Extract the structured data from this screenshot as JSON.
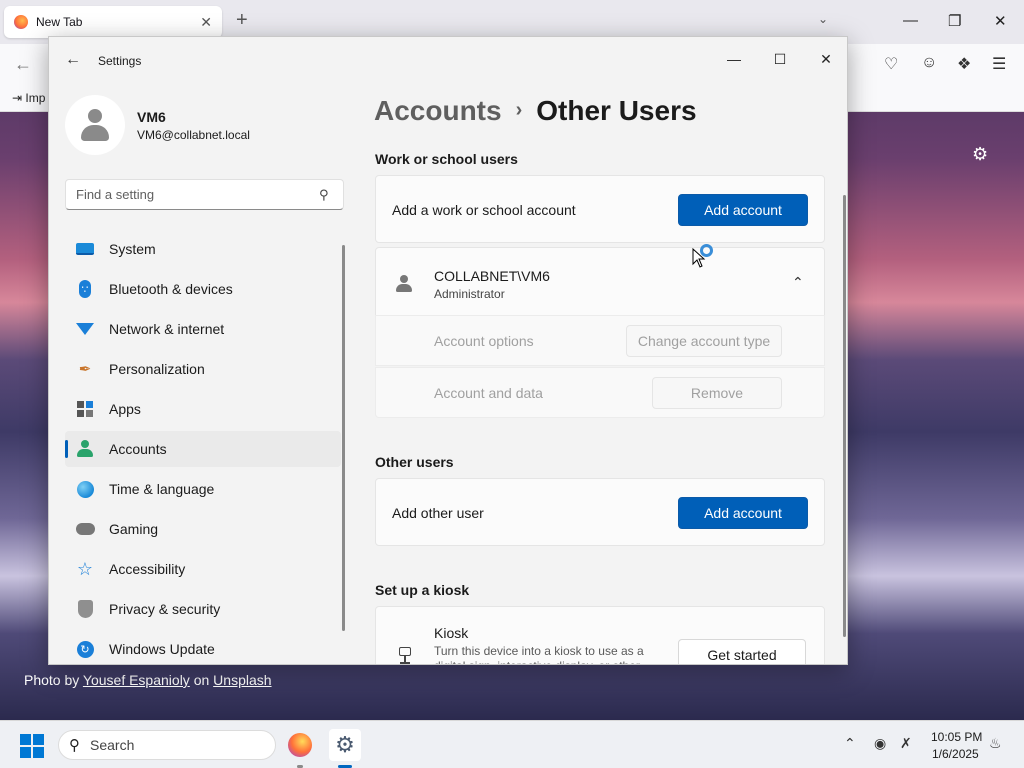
{
  "browser": {
    "tab_title": "New Tab",
    "tab_close": "✕",
    "new_tab": "+",
    "bookmark_import": "Imp",
    "photo_credit_prefix": "Photo by ",
    "photo_author": "Yousef Espanioly",
    "photo_credit_mid": " on ",
    "photo_site": "Unsplash"
  },
  "settings": {
    "window_title": "Settings",
    "profile": {
      "name": "VM6",
      "email": "VM6@collabnet.local"
    },
    "search": {
      "placeholder": "Find a setting"
    },
    "nav": [
      {
        "label": "System",
        "icon": "system-icon"
      },
      {
        "label": "Bluetooth & devices",
        "icon": "bluetooth-icon"
      },
      {
        "label": "Network & internet",
        "icon": "wifi-icon"
      },
      {
        "label": "Personalization",
        "icon": "brush-icon"
      },
      {
        "label": "Apps",
        "icon": "apps-icon"
      },
      {
        "label": "Accounts",
        "icon": "accounts-icon",
        "active": true
      },
      {
        "label": "Time & language",
        "icon": "globe-icon"
      },
      {
        "label": "Gaming",
        "icon": "gamepad-icon"
      },
      {
        "label": "Accessibility",
        "icon": "accessibility-icon"
      },
      {
        "label": "Privacy & security",
        "icon": "shield-icon"
      },
      {
        "label": "Windows Update",
        "icon": "update-icon"
      }
    ],
    "breadcrumb": {
      "parent": "Accounts",
      "separator": "›",
      "current": "Other Users"
    },
    "work_school": {
      "title": "Work or school users",
      "row_label": "Add a work or school account",
      "button": "Add account"
    },
    "user_entry": {
      "name": "COLLABNET\\VM6",
      "role": "Administrator",
      "options_label": "Account options",
      "options_button": "Change account type",
      "data_label": "Account and data",
      "data_button": "Remove"
    },
    "other_users": {
      "title": "Other users",
      "row_label": "Add other user",
      "button": "Add account"
    },
    "kiosk": {
      "title": "Set up a kiosk",
      "item_title": "Kiosk",
      "description": "Turn this device into a kiosk to use as a digital sign, interactive display, or other",
      "button": "Get started"
    }
  },
  "taskbar": {
    "search_label": "Search",
    "time": "10:05 PM",
    "date": "1/6/2025"
  },
  "colors": {
    "accent": "#005fb8",
    "desktop_top": "#40305a"
  }
}
